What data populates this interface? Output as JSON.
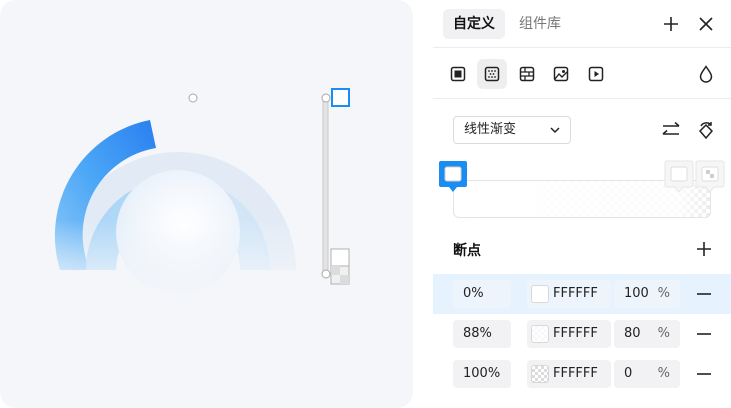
{
  "tabs": {
    "active": "自定义",
    "inactive": "组件库"
  },
  "header_icons": {
    "add": "plus-icon",
    "close": "close-icon"
  },
  "fill_types": [
    "solid-fill-icon",
    "gradient-fill-icon",
    "pattern-fill-icon",
    "image-fill-icon",
    "video-fill-icon"
  ],
  "gradient": {
    "type_label": "线性渐变",
    "reverse_icon": "swap-icon",
    "rotate_icon": "rotate-icon"
  },
  "stops_section": {
    "title": "断点",
    "add_icon": "plus-icon"
  },
  "stops": [
    {
      "position": "0%",
      "color": "FFFFFF",
      "opacity": "100",
      "unit": "%",
      "selected": true,
      "alpha": 1.0
    },
    {
      "position": "88%",
      "color": "FFFFFF",
      "opacity": "80",
      "unit": "%",
      "selected": false,
      "alpha": 0.8
    },
    {
      "position": "100%",
      "color": "FFFFFF",
      "opacity": "0",
      "unit": "%",
      "selected": false,
      "alpha": 0.0
    }
  ],
  "colors": {
    "accent": "#1a8cf2",
    "selected_row": "#e6f2fd",
    "canvas_bg": "#f4f6fa",
    "arc_blue": "#2f86f2",
    "arc_light": "#e4ecf5"
  }
}
